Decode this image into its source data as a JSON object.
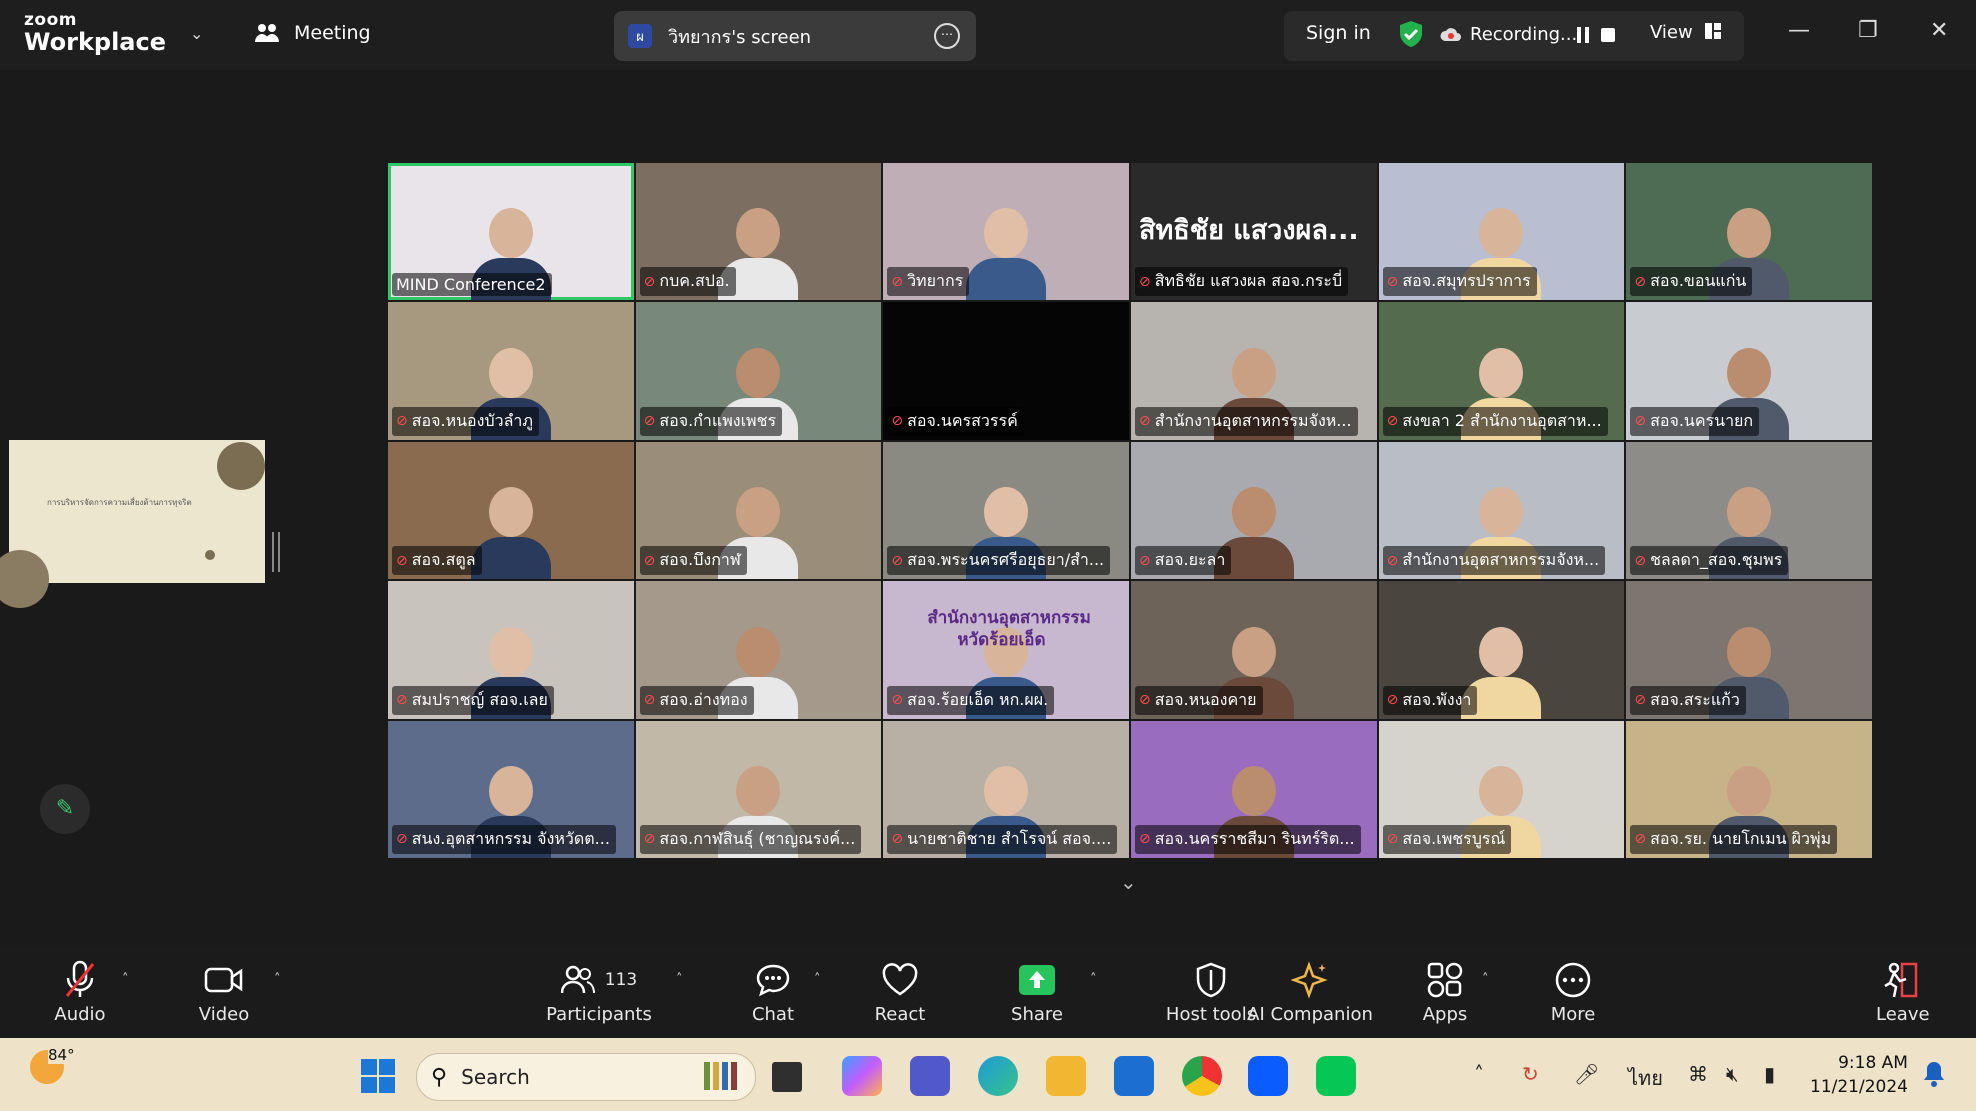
{
  "app": {
    "logo_top": "zoom",
    "logo_bottom": "Workplace"
  },
  "topbar": {
    "meeting_label": "Meeting",
    "share_avatar": "ผ",
    "share_title": "วิทยากร's screen",
    "sign_in": "Sign in",
    "recording": "Recording...",
    "view": "View"
  },
  "tiles": [
    {
      "name": "MIND Conference2",
      "muted": false,
      "active": true,
      "bg": "#e9e4ea"
    },
    {
      "name": "กบค.สปอ.",
      "muted": true,
      "bg": "#7c6f62"
    },
    {
      "name": "วิทยากร",
      "muted": true,
      "bg": "#bfaeb5"
    },
    {
      "name": "สิทธิชัย  แสวงผล สอจ.กระบี่",
      "muted": true,
      "bg": "#2a2a2a",
      "big": "สิทธิชัย  แสวงผล..."
    },
    {
      "name": "สอจ.สมุทรปราการ",
      "muted": true,
      "bg": "#b9bfd0"
    },
    {
      "name": "สอจ.ขอนแก่น",
      "muted": true,
      "bg": "#4e6b54"
    },
    {
      "name": "สอจ.หนองบัวลำภู",
      "muted": true,
      "bg": "#a79980"
    },
    {
      "name": "สอจ.กำแพงเพชร",
      "muted": true,
      "bg": "#78887a"
    },
    {
      "name": "สอจ.นครสวรรค์",
      "muted": true,
      "bg": "#050505"
    },
    {
      "name": "สำนักงานอุตสาหกรรมจังห...",
      "muted": true,
      "bg": "#b7b3ae"
    },
    {
      "name": "สงขลา 2 สำนักงานอุตสาห...",
      "muted": true,
      "bg": "#556b4e"
    },
    {
      "name": "สอจ.นครนายก",
      "muted": true,
      "bg": "#c8cbd0"
    },
    {
      "name": "สอจ.สตูล",
      "muted": true,
      "bg": "#8b6b50"
    },
    {
      "name": "สอจ.บึงกาฬ",
      "muted": true,
      "bg": "#9a8d79"
    },
    {
      "name": "สอจ.พระนครศรีอยุธยา/สำ...",
      "muted": true,
      "bg": "#8a8a82"
    },
    {
      "name": "สอจ.ยะลา",
      "muted": true,
      "bg": "#a8aab0"
    },
    {
      "name": "สำนักงานอุตสาหกรรมจังห...",
      "muted": true,
      "bg": "#b9bdc6"
    },
    {
      "name": "ชลลดา_สอจ.ชุมพร",
      "muted": true,
      "bg": "#8d8c89"
    },
    {
      "name": "สมปราชญ์ สอจ.เลย",
      "muted": true,
      "bg": "#c9c3bd"
    },
    {
      "name": "สอจ.อ่างทอง",
      "muted": true,
      "bg": "#a5998c"
    },
    {
      "name": "สอจ.ร้อยเอ็ด หก.ผผ.",
      "muted": true,
      "bg": "#c7b8cf"
    },
    {
      "name": "สอจ.หนองคาย",
      "muted": true,
      "bg": "#6d6358"
    },
    {
      "name": "สอจ.พังงา",
      "muted": true,
      "bg": "#4a463f"
    },
    {
      "name": "สอจ.สระแก้ว",
      "muted": true,
      "bg": "#7c7570"
    },
    {
      "name": "สนง.อุตสาหกรรม จังหวัดต...",
      "muted": true,
      "bg": "#5e6c8c"
    },
    {
      "name": "สอจ.กาฬสินธุ์ (ชาญณรงค์...",
      "muted": true,
      "bg": "#c1b8a8"
    },
    {
      "name": "นายชาติชาย สำโรจน์ สอจ....",
      "muted": true,
      "bg": "#b8b0a4"
    },
    {
      "name": "สอจ.นครราชสีมา รินทร์ริต...",
      "muted": true,
      "bg": "#9a6cc0"
    },
    {
      "name": "สอจ.เพชรบูรณ์",
      "muted": true,
      "bg": "#d6d2cc"
    },
    {
      "name": "สอจ.รย. นายโกเมน ผิวพุ่ม",
      "muted": true,
      "bg": "#c6b488"
    }
  ],
  "tile_texts": {
    "t19_banner": "สำนักงานอุตสาหกรรม",
    "t19_banner2": "หวัดร้อยเอ็ด"
  },
  "thumbnail": {
    "title": "การบริหารจัดการความเสี่ยงด้านการทุจริต"
  },
  "toolbar": {
    "audio": "Audio",
    "video": "Video",
    "participants": "Participants",
    "participants_count": "113",
    "chat": "Chat",
    "react": "React",
    "share": "Share",
    "host_tools": "Host tools",
    "ai_companion": "AI Companion",
    "apps": "Apps",
    "more": "More",
    "leave": "Leave"
  },
  "taskbar": {
    "temperature": "84°",
    "search_placeholder": "Search",
    "language": "ไทย",
    "time": "9:18 AM",
    "date": "11/21/2024"
  }
}
